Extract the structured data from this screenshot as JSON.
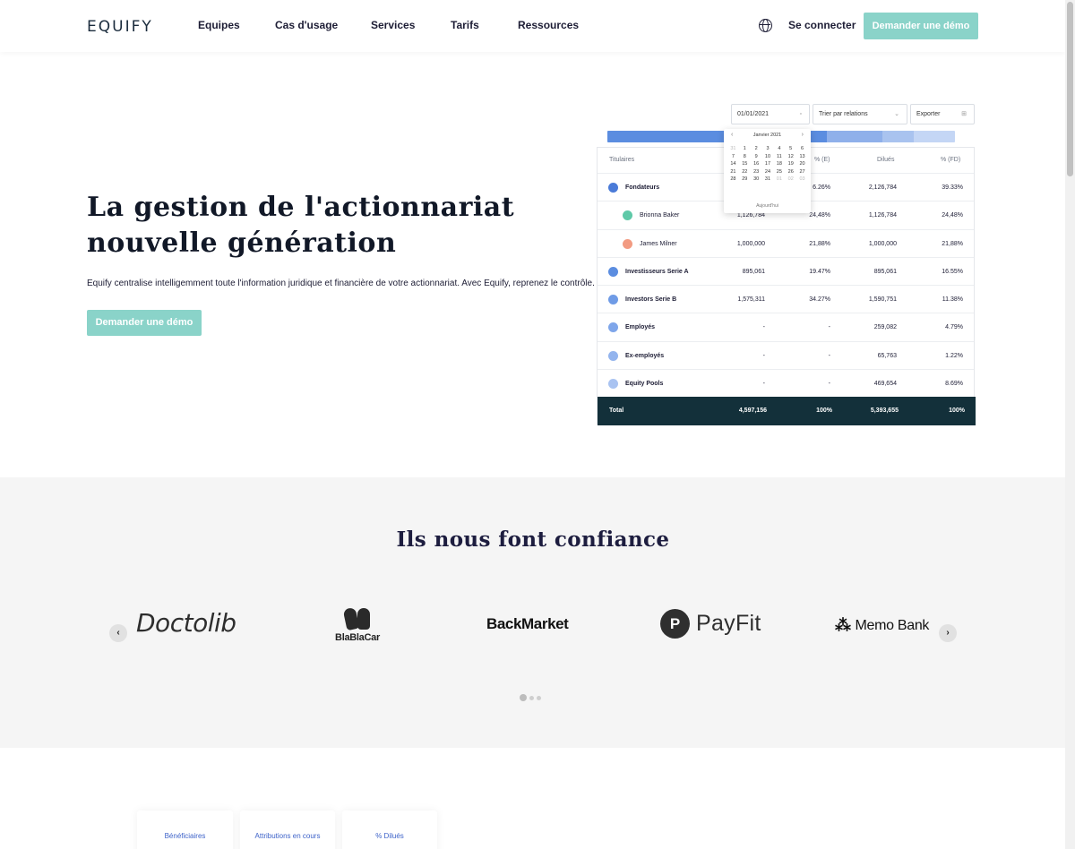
{
  "nav": {
    "logo": "EQUIFY",
    "links": [
      "Equipes",
      "Cas d'usage",
      "Services",
      "Tarifs",
      "Ressources"
    ],
    "language_icon": "globe-icon",
    "signin": "Se connecter",
    "demo": "Demander une démo"
  },
  "hero": {
    "title": "La gestion de l'actionnariat nouvelle génération",
    "subtitle": "Equify centralise intelligemment toute l'information juridique et financière de votre actionnariat. Avec Equify, reprenez le contrôle.",
    "demo": "Demander une démo"
  },
  "mockup": {
    "date_value": "01/01/2021",
    "sort_label": "Trier par relations",
    "export_label": "Exporter",
    "calendar": {
      "month": "Janvier 2021",
      "days": [
        "31",
        "1",
        "2",
        "3",
        "4",
        "5",
        "6",
        "7",
        "8",
        "9",
        "10",
        "11",
        "12",
        "13",
        "14",
        "15",
        "16",
        "17",
        "18",
        "19",
        "20",
        "21",
        "22",
        "23",
        "24",
        "25",
        "26",
        "27",
        "28",
        "29",
        "30",
        "31",
        "01",
        "02",
        "03"
      ],
      "today": "Aujourd'hui"
    },
    "headers": [
      "Titulaires",
      "% (E)",
      "Dilués",
      "% (FD)"
    ],
    "rows": [
      {
        "name": "Fondateurs",
        "e": "",
        "pe": "6.26%",
        "d": "2,126,784",
        "pfd": "39.33%",
        "bold": true,
        "color": "#4a7bd8"
      },
      {
        "name": "Brionna Baker",
        "e": "1,126,784",
        "pe": "24,48%",
        "d": "1,126,784",
        "pfd": "24,48%",
        "bold": false,
        "color": "#5fc9a8"
      },
      {
        "name": "James Milner",
        "e": "1,000,000",
        "pe": "21,88%",
        "d": "1,000,000",
        "pfd": "21,88%",
        "bold": false,
        "color": "#f29b82"
      },
      {
        "name": "Investisseurs Serie A",
        "e": "895,061",
        "pe": "19.47%",
        "d": "895,061",
        "pfd": "16.55%",
        "bold": true,
        "color": "#5b8de0"
      },
      {
        "name": "Investors Serie B",
        "e": "1,575,311",
        "pe": "34.27%",
        "d": "1,590,751",
        "pfd": "11.38%",
        "bold": true,
        "color": "#6f9be6"
      },
      {
        "name": "Employés",
        "e": "-",
        "pe": "-",
        "d": "259,082",
        "pfd": "4.79%",
        "bold": true,
        "color": "#7fa6ea"
      },
      {
        "name": "Ex-employés",
        "e": "-",
        "pe": "-",
        "d": "65,763",
        "pfd": "1.22%",
        "bold": true,
        "color": "#93b4ee"
      },
      {
        "name": "Equity Pools",
        "e": "-",
        "pe": "-",
        "d": "469,654",
        "pfd": "8.69%",
        "bold": true,
        "color": "#a9c3f1"
      }
    ],
    "total": {
      "name": "Total",
      "e": "4,597,156",
      "pe": "100%",
      "d": "5,393,655",
      "pfd": "100%"
    }
  },
  "trust": {
    "title": "Ils nous font confiance",
    "logos": [
      "Doctolib",
      "BlaBlaCar",
      "BackMarket",
      "PayFit",
      "Memo Bank"
    ],
    "prev_icon": "chevron-left-icon",
    "next_icon": "chevron-right-icon"
  },
  "bottom_cards": [
    "Bénéficiaires",
    "Attributions en cours",
    "% Dilués"
  ]
}
